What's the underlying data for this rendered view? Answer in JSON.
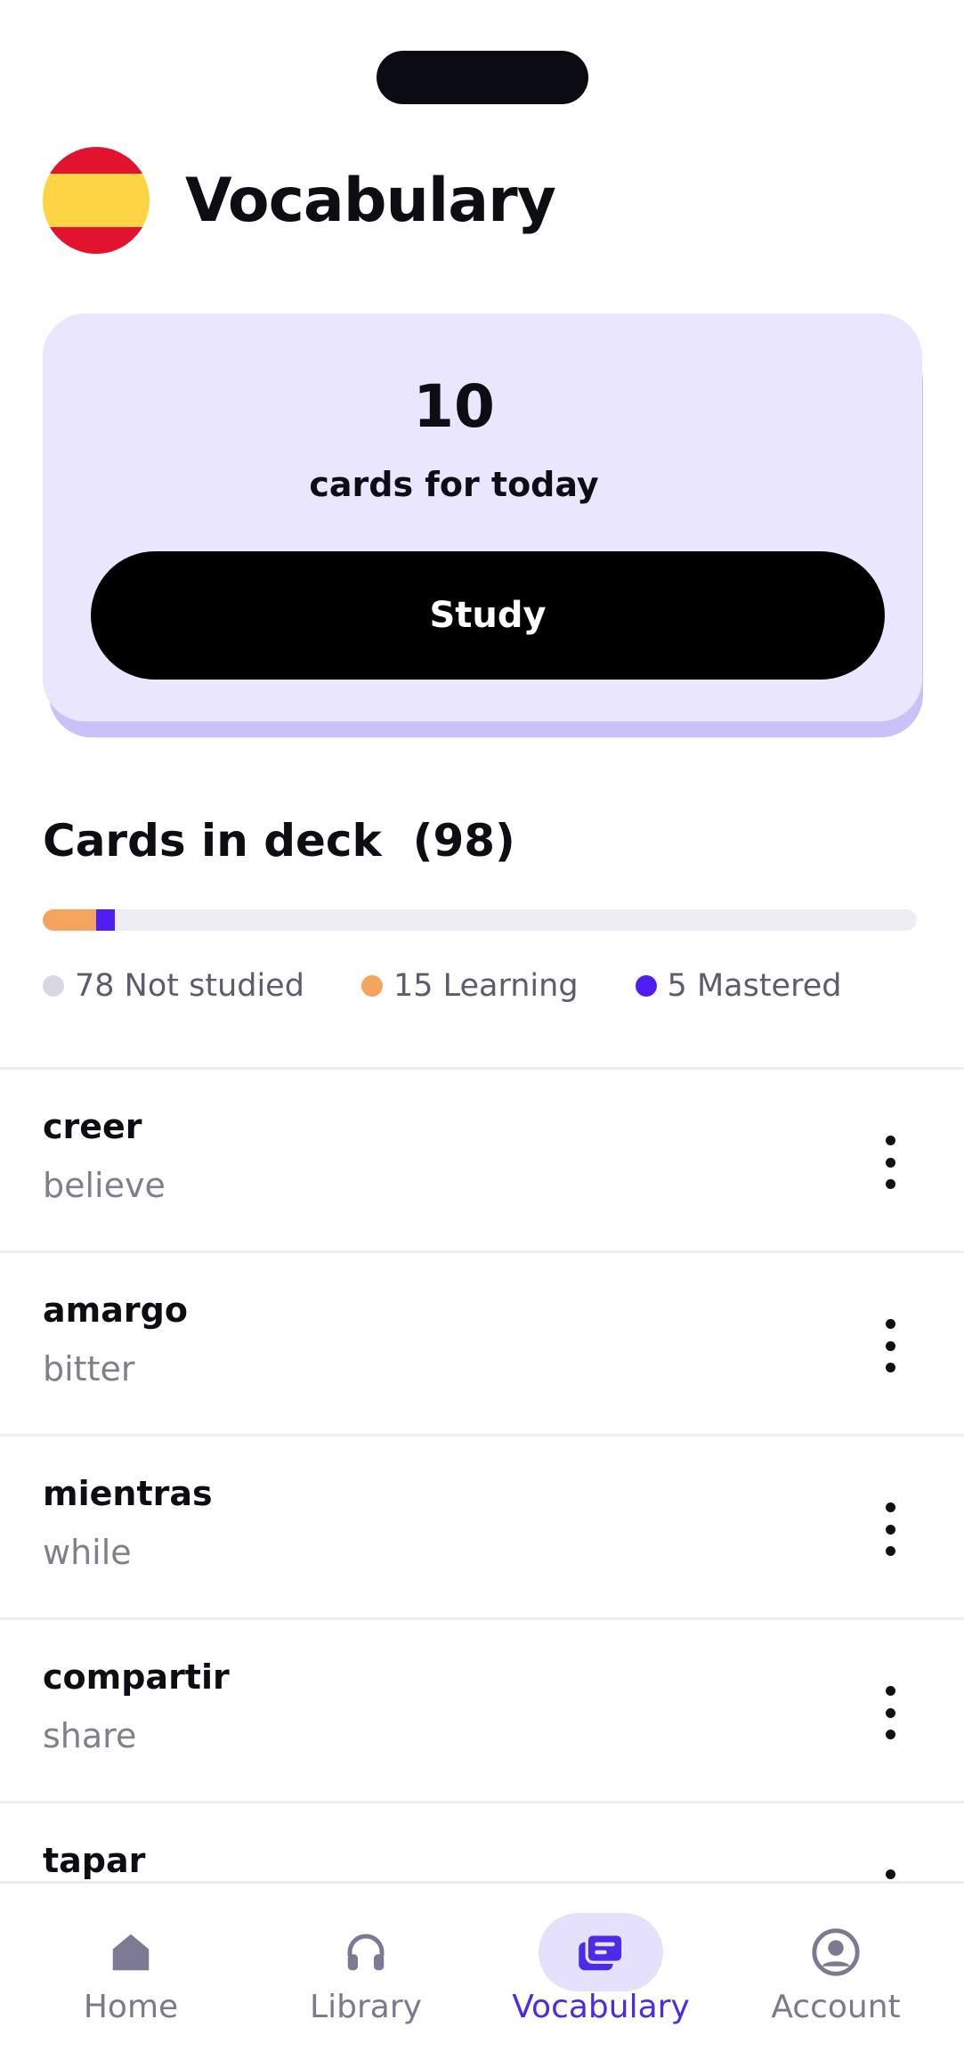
{
  "header": {
    "title": "Vocabulary",
    "flag_icon": "spain-flag-icon"
  },
  "today": {
    "count": "10",
    "label": "cards for today",
    "study_label": "Study"
  },
  "deck": {
    "title": "Cards in deck  (98)",
    "total": 98,
    "legend": [
      {
        "label": "78 Not studied",
        "count": 78,
        "color": "#d9d8e2"
      },
      {
        "label": "15 Learning",
        "count": 15,
        "color": "#f5a45e"
      },
      {
        "label": "5 Mastered",
        "count": 5,
        "color": "#4f1ef0"
      }
    ],
    "progress_learning_fraction": 0.061,
    "progress_mastered_fraction": 0.021
  },
  "cards": [
    {
      "term": "creer",
      "meaning": "believe"
    },
    {
      "term": "amargo",
      "meaning": "bitter"
    },
    {
      "term": "mientras",
      "meaning": "while"
    },
    {
      "term": "compartir",
      "meaning": "share"
    },
    {
      "term": "tapar",
      "meaning": ""
    }
  ],
  "tabs": [
    {
      "label": "Home",
      "icon": "home-icon",
      "active": false
    },
    {
      "label": "Library",
      "icon": "headphones-icon",
      "active": false
    },
    {
      "label": "Vocabulary",
      "icon": "cards-icon",
      "active": true
    },
    {
      "label": "Account",
      "icon": "account-icon",
      "active": false
    }
  ],
  "colors": {
    "accent": "#4c2be8",
    "card_bg": "#e9e6fd",
    "learning": "#f5a45e",
    "mastered": "#4f1ef0"
  }
}
